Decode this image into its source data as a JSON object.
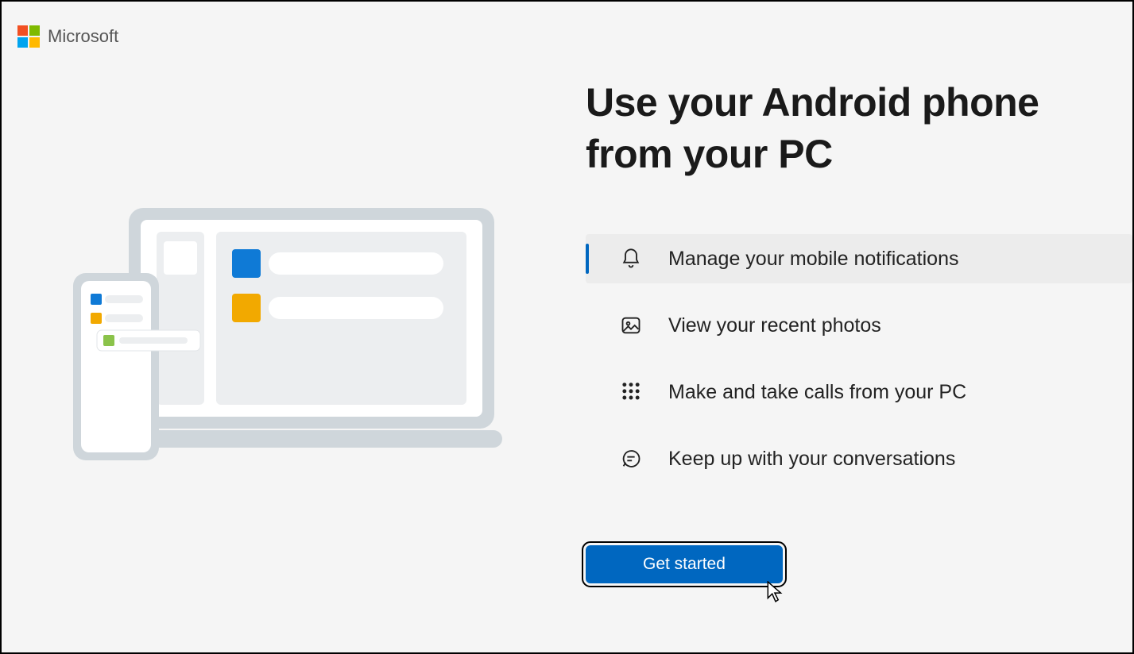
{
  "brand": "Microsoft",
  "heading": "Use your Android phone from your PC",
  "features": [
    {
      "label": "Manage your mobile notifications",
      "active": true
    },
    {
      "label": "View your recent photos",
      "active": false
    },
    {
      "label": "Make and take calls from your PC",
      "active": false
    },
    {
      "label": "Keep up with your conversations",
      "active": false
    }
  ],
  "cta": "Get started",
  "colors": {
    "accent": "#0067c0"
  }
}
